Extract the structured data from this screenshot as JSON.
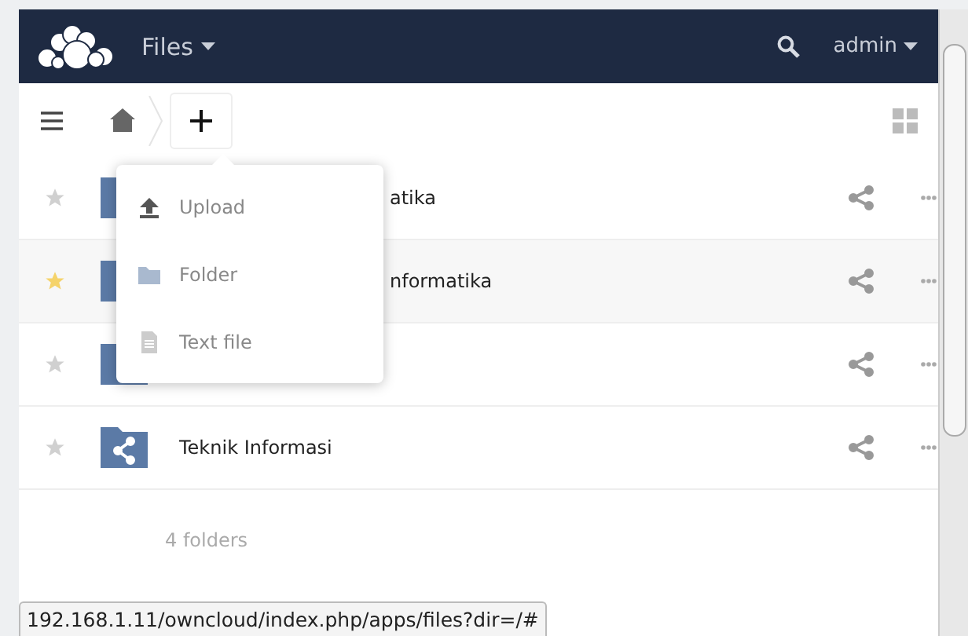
{
  "header": {
    "app_title": "Files",
    "user": "admin"
  },
  "new_menu": {
    "items": [
      {
        "kind": "upload",
        "label": "Upload"
      },
      {
        "kind": "folder",
        "label": "Folder"
      },
      {
        "kind": "text",
        "label": "Text file"
      }
    ]
  },
  "files": [
    {
      "name": "atika",
      "shared": false,
      "highlighted": false
    },
    {
      "name": "nformatika",
      "shared": false,
      "highlighted": true
    },
    {
      "shared": false,
      "highlighted": false
    },
    {
      "name": "Teknik Informasi",
      "shared": true,
      "highlighted": false
    }
  ],
  "summary": "4 folders",
  "status_url": "192.168.1.11/owncloud/index.php/apps/files?dir=/#"
}
